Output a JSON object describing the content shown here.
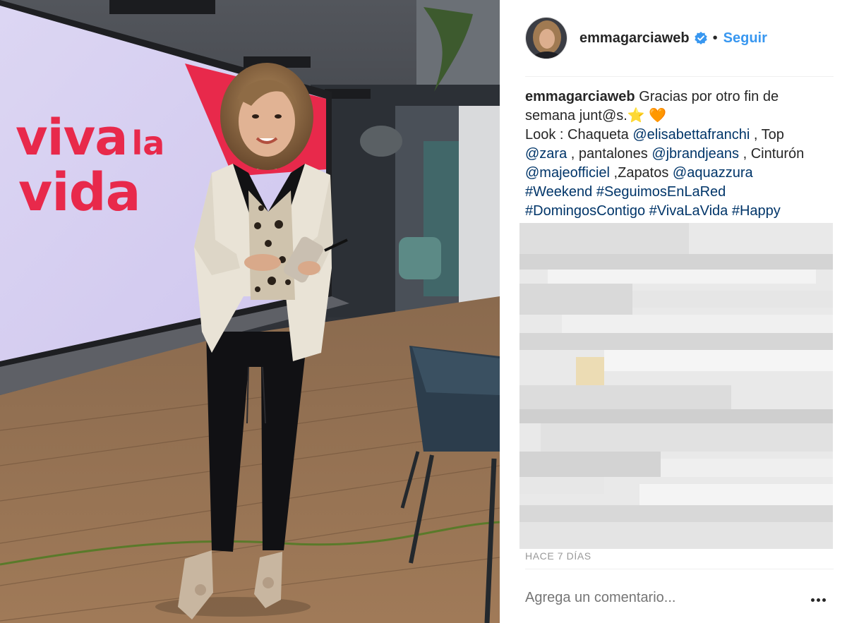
{
  "post": {
    "username": "emmagarciaweb",
    "separator": "•",
    "follow_label": "Seguir",
    "verified_icon": "verified-badge-icon",
    "accent_color": "#3897f0",
    "link_color": "#003569"
  },
  "caption": {
    "author": "emmagarciaweb",
    "line1_text": "Gracias por otro fin de",
    "line2_text": "semana junt@s.",
    "star_emoji": "⭐",
    "heart_emoji": "🧡",
    "look_label": "Look : Chaqueta ",
    "mention_1": "@elisabettafranchi",
    "top_label": " , Top",
    "mention_2": "@zara",
    "pantalones_label": " , pantalones ",
    "mention_3": "@jbrandjeans",
    "cinturon_label": " , Cinturón",
    "mention_4": "@majeofficiel",
    "zapatos_label": " ,Zapatos ",
    "mention_5": "@aquazzura",
    "hashtag_1": "#Weekend",
    "hashtag_2": "#SeguimosEnLaRed",
    "hashtag_3": "#DomingosContigo",
    "hashtag_4": "#VivaLaVida",
    "hashtag_5": "#Happy"
  },
  "meta": {
    "timestamp": "HACE 7 DÍAS",
    "comment_placeholder": "Agrega un comentario...",
    "more_options_icon": "ellipsis-icon"
  },
  "photo": {
    "logo_word_1": "viva",
    "logo_word_2": "la",
    "logo_word_3": "vida",
    "logo_color": "#e8294b"
  }
}
